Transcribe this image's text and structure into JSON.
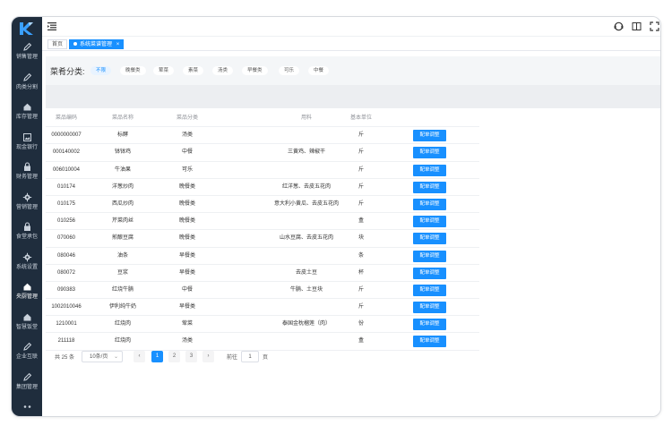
{
  "sidebar": {
    "items": [
      {
        "label": "销售管理",
        "icon": "pencil-icon"
      },
      {
        "label": "肉类分割",
        "icon": "pencil-icon"
      },
      {
        "label": "库存管理",
        "icon": "home-icon"
      },
      {
        "label": "现金银行",
        "icon": "image-icon"
      },
      {
        "label": "财务管理",
        "icon": "lock-icon"
      },
      {
        "label": "营销管理",
        "icon": "gear-icon"
      },
      {
        "label": "食堂承包",
        "icon": "lock-icon"
      },
      {
        "label": "系统设置",
        "icon": "gear-icon"
      },
      {
        "label": "央厨管理",
        "icon": "home-icon"
      },
      {
        "label": "智慧饭堂",
        "icon": "home-icon"
      },
      {
        "label": "企业互联",
        "icon": "pencil-icon"
      },
      {
        "label": "集团管理",
        "icon": "pencil-icon"
      },
      {
        "label": "",
        "icon": "dots-icon"
      }
    ]
  },
  "tags": {
    "home": "首页",
    "current": "系统菜谱管理",
    "close": "×"
  },
  "filter": {
    "title": "菜肴分类:",
    "chips": [
      "不限",
      "晚餐类",
      "荤菜",
      "素菜",
      "汤类",
      "早餐类",
      "可乐",
      "中餐"
    ]
  },
  "table": {
    "headers": [
      "菜品编码",
      "菜品名称",
      "菜品分类",
      "用料",
      "基本单位",
      ""
    ],
    "action_label": "配单调整",
    "rows": [
      [
        "0000000007",
        "标酵",
        "汤类",
        "",
        "斤"
      ],
      [
        "000140002",
        "钵钵鸡",
        "中餐",
        "三黄鸡、辣椒干",
        "斤"
      ],
      [
        "006010004",
        "牛油果",
        "可乐",
        "",
        "斤"
      ],
      [
        "010174",
        "洋葱炒肉",
        "晚餐类",
        "红洋葱、去皮五花肉",
        "斤"
      ],
      [
        "010175",
        "西瓜炒肉",
        "晚餐类",
        "意大利小黄瓜、去皮五花肉",
        "斤"
      ],
      [
        "010256",
        "芹菜肉丝",
        "晚餐类",
        "",
        "盒"
      ],
      [
        "070060",
        "煎酿豆腐",
        "晚餐类",
        "山水豆腐、去皮五花肉",
        "块"
      ],
      [
        "080046",
        "油条",
        "早餐类",
        "",
        "条"
      ],
      [
        "080072",
        "豆浆",
        "早餐类",
        "去皮土豆",
        "杯"
      ],
      [
        "090383",
        "红烧牛腩",
        "中餐",
        "牛腩、土豆块",
        "斤"
      ],
      [
        "1002010046",
        "伊利纯牛奶",
        "早餐类",
        "",
        "斤"
      ],
      [
        "1210001",
        "红烧肉",
        "荤菜",
        "泰国金枕榴莲（肉）",
        "份"
      ],
      [
        "211118",
        "红烧肉",
        "汤类",
        "",
        "盒"
      ]
    ]
  },
  "pagination": {
    "total": "共 25 条",
    "page_size": "10条/页",
    "pages": [
      "1",
      "2",
      "3"
    ],
    "current_page": 1,
    "goto_label": "前往",
    "goto_value": "1",
    "page_unit": "页",
    "prev": "‹",
    "next": "›"
  },
  "colors": {
    "sidebar_bg": "#1f2d3d",
    "accent": "#1890ff"
  }
}
